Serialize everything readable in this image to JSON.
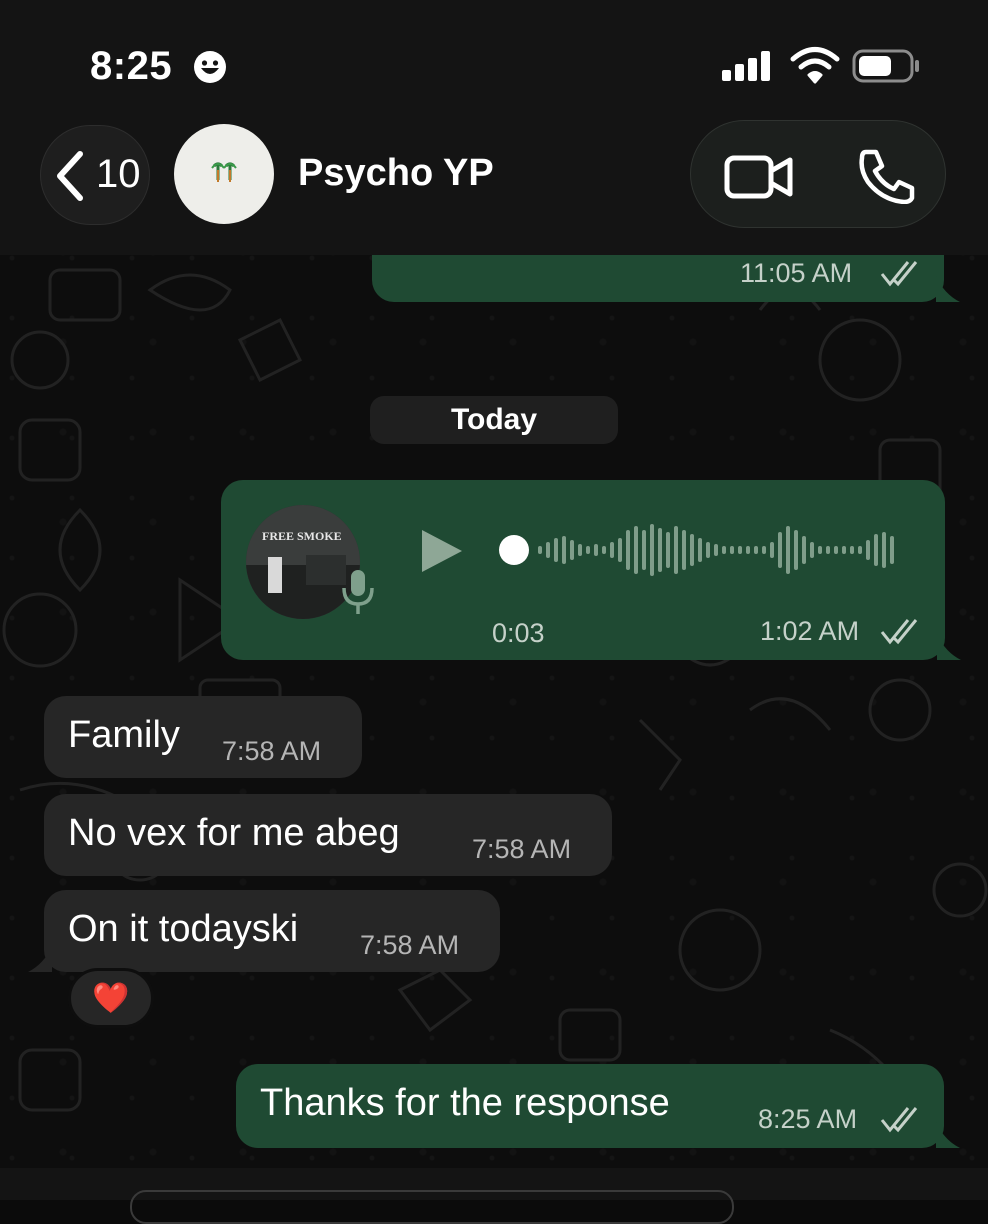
{
  "status_bar": {
    "time": "8:25",
    "icons": [
      "smiley-face-icon",
      "cellular-signal-icon",
      "wifi-icon",
      "battery-icon"
    ]
  },
  "header": {
    "back_count": "10",
    "contact_name": "Psycho YP",
    "avatar_icon": "palm-trees-icon",
    "actions": [
      "video-call-icon",
      "voice-call-icon"
    ]
  },
  "messages": {
    "prev_outgoing_time": "11:05 AM",
    "date_separator": "Today",
    "voice_note": {
      "duration": "0:03",
      "time": "1:02 AM",
      "thumbnail_text": "FREE SMOKE",
      "progress": 0
    },
    "incoming": [
      {
        "text": "Family",
        "time": "7:58 AM"
      },
      {
        "text": "No vex for me abeg",
        "time": "7:58 AM"
      },
      {
        "text": "On it todayski",
        "time": "7:58 AM",
        "reaction": "❤️"
      }
    ],
    "outgoing_last": {
      "text": "Thanks for the response",
      "time": "8:25 AM"
    }
  },
  "colors": {
    "outgoing_bubble": "#1f4a33",
    "incoming_bubble": "#262626",
    "header_bg": "#141414",
    "chat_bg": "#0d0d0d"
  }
}
